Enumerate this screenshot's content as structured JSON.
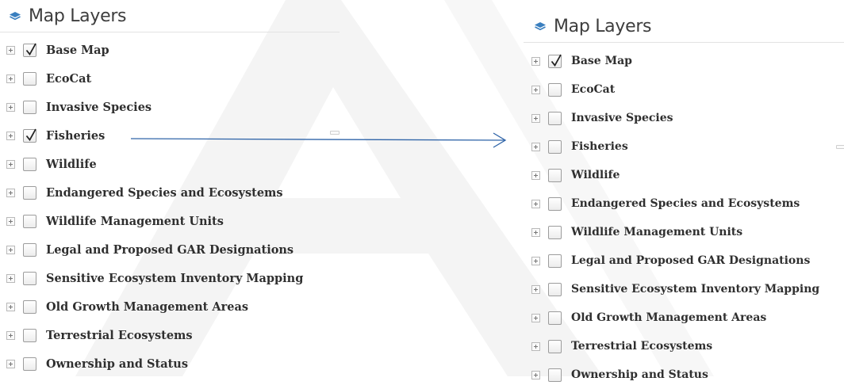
{
  "title": "Map Layers",
  "icon": "layers-icon",
  "colors": {
    "arrow": "#2f64a8",
    "text": "#2f2f2f",
    "title": "#3d3d3d"
  },
  "left_panel": {
    "layers": [
      {
        "label": "Base Map",
        "checked": true
      },
      {
        "label": "EcoCat",
        "checked": false
      },
      {
        "label": "Invasive Species",
        "checked": false
      },
      {
        "label": "Fisheries",
        "checked": true
      },
      {
        "label": "Wildlife",
        "checked": false
      },
      {
        "label": "Endangered Species and Ecosystems",
        "checked": false
      },
      {
        "label": "Wildlife Management Units",
        "checked": false
      },
      {
        "label": "Legal and Proposed GAR Designations",
        "checked": false
      },
      {
        "label": "Sensitive Ecosystem Inventory Mapping",
        "checked": false
      },
      {
        "label": "Old Growth Management Areas",
        "checked": false
      },
      {
        "label": "Terrestrial Ecosystems",
        "checked": false
      },
      {
        "label": "Ownership and Status",
        "checked": false
      }
    ]
  },
  "right_panel": {
    "layers": [
      {
        "label": "Base Map",
        "checked": true
      },
      {
        "label": "EcoCat",
        "checked": false
      },
      {
        "label": "Invasive Species",
        "checked": false
      },
      {
        "label": "Fisheries",
        "checked": false
      },
      {
        "label": "Wildlife",
        "checked": false
      },
      {
        "label": "Endangered Species and Ecosystems",
        "checked": false
      },
      {
        "label": "Wildlife Management Units",
        "checked": false
      },
      {
        "label": "Legal and Proposed GAR Designations",
        "checked": false
      },
      {
        "label": "Sensitive Ecosystem Inventory Mapping",
        "checked": false
      },
      {
        "label": "Old Growth Management Areas",
        "checked": false
      },
      {
        "label": "Terrestrial Ecosystems",
        "checked": false
      },
      {
        "label": "Ownership and Status",
        "checked": false
      }
    ]
  }
}
